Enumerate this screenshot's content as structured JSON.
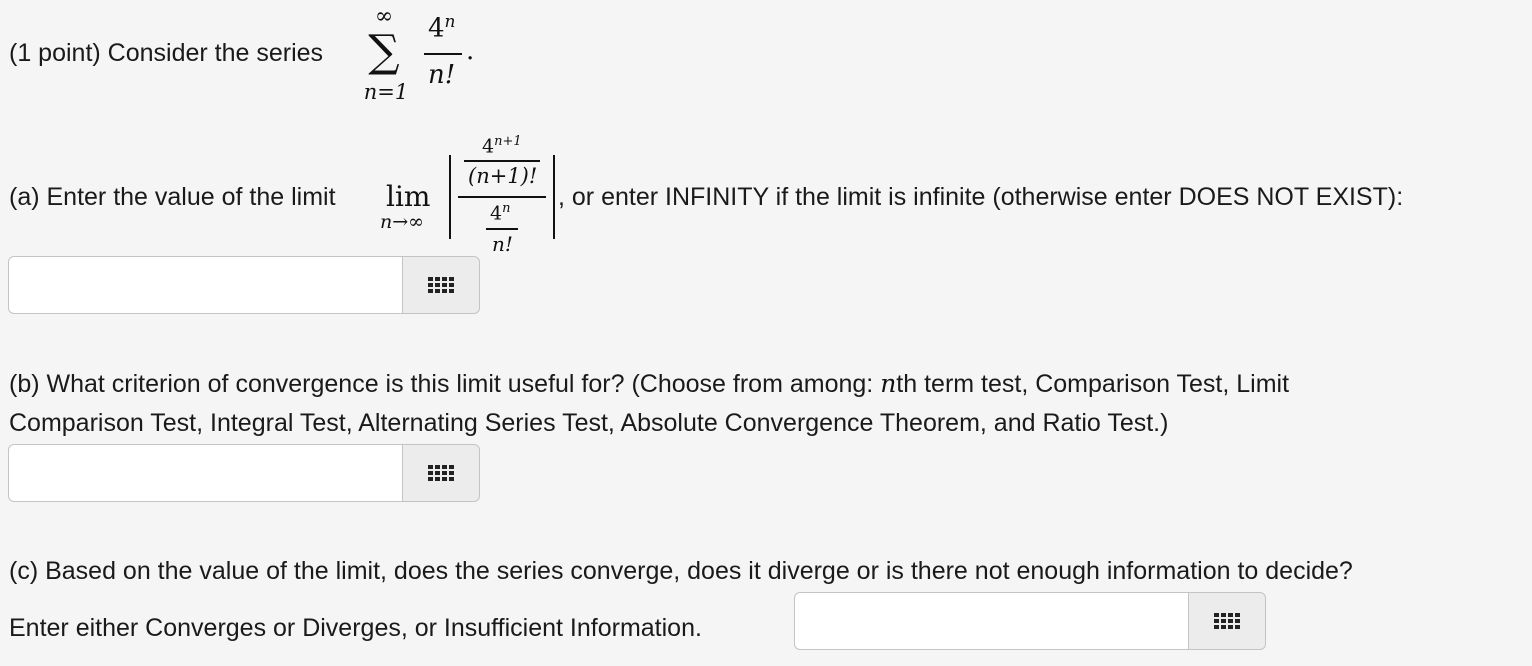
{
  "intro": {
    "prefix": "(1 point) Consider the series",
    "sum_upper": "∞",
    "sum_symbol": "∑",
    "sum_lower": "n=1",
    "numerator": "4",
    "numerator_exp": "n",
    "denominator": "n!",
    "period": "."
  },
  "part_a": {
    "prefix": "(a) Enter the value of the limit",
    "lim_word": "lim",
    "lim_sub": "n→∞",
    "top_num": "4",
    "top_num_exp": "n+1",
    "top_den": "(n+1)!",
    "bot_num": "4",
    "bot_num_exp": "n",
    "bot_den": "n!",
    "suffix": ", or enter INFINITY if the limit is infinite (otherwise enter DOES NOT EXIST):",
    "input_value": ""
  },
  "part_b": {
    "line1_pre": "(b) What criterion of convergence is this limit useful for? (Choose from among: ",
    "line1_n": "n",
    "line1_post": "th term test, Comparison Test, Limit",
    "line2": "Comparison Test, Integral Test, Alternating Series Test, Absolute Convergence Theorem, and Ratio Test.)",
    "input_value": ""
  },
  "part_c": {
    "line1": "(c) Based on the value of the limit, does the series converge, does it diverge or is there not enough information to decide?",
    "line2": "Enter either Converges or Diverges, or Insufficient Information.",
    "input_value": ""
  },
  "icons": {
    "keypad": "keypad-grid-icon"
  }
}
